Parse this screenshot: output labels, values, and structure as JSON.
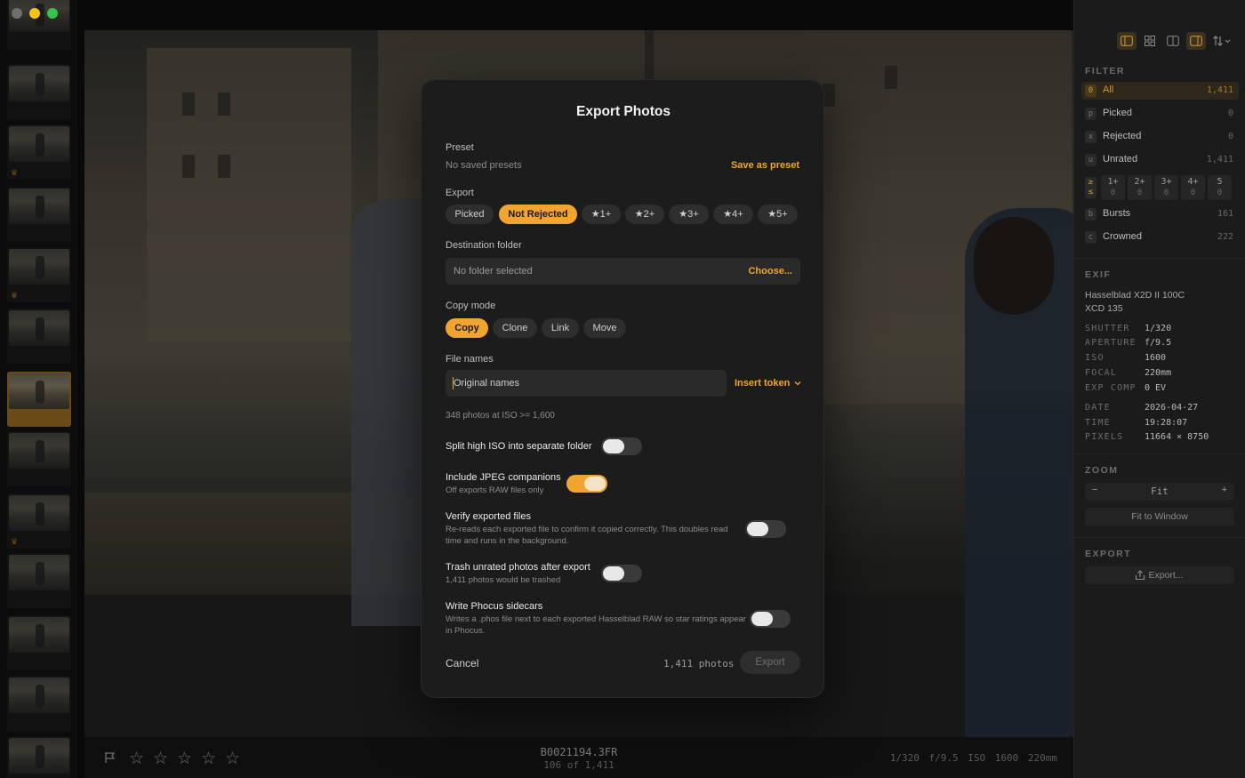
{
  "window": {
    "traffic_lights": [
      "close",
      "minimize",
      "zoom"
    ]
  },
  "filmstrip": {
    "thumbnails": [
      {
        "crowned": false,
        "selected": false
      },
      {
        "crowned": false,
        "selected": false
      },
      {
        "crowned": true,
        "selected": false
      },
      {
        "crowned": false,
        "selected": false
      },
      {
        "crowned": true,
        "selected": false
      },
      {
        "crowned": false,
        "selected": false
      },
      {
        "crowned": false,
        "selected": true
      },
      {
        "crowned": false,
        "selected": false
      },
      {
        "crowned": true,
        "selected": false
      },
      {
        "crowned": false,
        "selected": false
      },
      {
        "crowned": false,
        "selected": false
      },
      {
        "crowned": false,
        "selected": false
      },
      {
        "crowned": false,
        "selected": false
      }
    ],
    "crown_glyph": "♛"
  },
  "bottombar": {
    "filename": "B0021194.3FR",
    "position": "106 of 1,411",
    "exif_summary": "1/320  f/9.5  ISO 1600  220mm",
    "stars": [
      "☆",
      "☆",
      "☆",
      "☆",
      "☆"
    ]
  },
  "sidebar": {
    "toolbar_icons": [
      "sidebar-left-icon",
      "grid-icon",
      "compare-icon",
      "sidebar-right-icon",
      "sort-icon"
    ],
    "filter": {
      "title": "FILTER",
      "rows": [
        {
          "key": "0",
          "label": "All",
          "count": "1,411",
          "active": true
        },
        {
          "key": "p",
          "label": "Picked",
          "count": "0",
          "active": false
        },
        {
          "key": "x",
          "label": "Rejected",
          "count": "0",
          "active": false
        },
        {
          "key": "u",
          "label": "Unrated",
          "count": "1,411",
          "active": false
        }
      ],
      "star_key": "≥\n≤",
      "star_cells": [
        {
          "label": "1+",
          "count": "0"
        },
        {
          "label": "2+",
          "count": "0"
        },
        {
          "label": "3+",
          "count": "0"
        },
        {
          "label": "4+",
          "count": "0"
        },
        {
          "label": "5",
          "count": "0"
        }
      ],
      "extra_rows": [
        {
          "key": "b",
          "label": "Bursts",
          "count": "161"
        },
        {
          "key": "c",
          "label": "Crowned",
          "count": "222"
        }
      ]
    },
    "exif": {
      "title": "EXIF",
      "camera": "Hasselblad X2D II 100C",
      "lens": "XCD 135",
      "rows": [
        {
          "k": "SHUTTER",
          "v": "1/320"
        },
        {
          "k": "APERTURE",
          "v": "f/9.5"
        },
        {
          "k": "ISO",
          "v": "1600"
        },
        {
          "k": "FOCAL",
          "v": "220mm"
        },
        {
          "k": "EXP COMP",
          "v": "0 EV"
        }
      ],
      "rows2": [
        {
          "k": "DATE",
          "v": "2026-04-27"
        },
        {
          "k": "TIME",
          "v": "19:28:07"
        },
        {
          "k": "PIXELS",
          "v": "11664 × 8750"
        }
      ]
    },
    "zoom": {
      "title": "ZOOM",
      "minus": "−",
      "value": "Fit",
      "plus": "+",
      "fit_button": "Fit to Window"
    },
    "export": {
      "title": "EXPORT",
      "button": "Export..."
    }
  },
  "modal": {
    "title": "Export Photos",
    "preset": {
      "label": "Preset",
      "value": "No saved presets",
      "save_link": "Save as preset"
    },
    "export": {
      "label": "Export",
      "options": [
        "Picked",
        "Not Rejected",
        "★1+",
        "★2+",
        "★3+",
        "★4+",
        "★5+"
      ],
      "selected": "Not Rejected"
    },
    "destination": {
      "label": "Destination folder",
      "value": "No folder selected",
      "choose": "Choose..."
    },
    "copy_mode": {
      "label": "Copy mode",
      "options": [
        "Copy",
        "Clone",
        "Link",
        "Move"
      ],
      "selected": "Copy"
    },
    "file_names": {
      "label": "File names",
      "value": "Original names",
      "insert_token": "Insert token"
    },
    "iso_note": "348 photos at ISO >= 1,600",
    "options": [
      {
        "title": "Split high ISO into separate folder",
        "desc": "",
        "on": false
      },
      {
        "title": "Include JPEG companions",
        "desc": "Off exports RAW files only",
        "on": true
      },
      {
        "title": "Verify exported files",
        "desc": "Re-reads each exported file to confirm it copied correctly. This doubles read time and runs in the background.",
        "on": false
      },
      {
        "title": "Trash unrated photos after export",
        "desc": "1,411 photos would be trashed",
        "on": false
      },
      {
        "title": "Write Phocus sidecars",
        "desc": "Writes a .phos file next to each exported Hasselblad RAW so star ratings appear in Phocus.",
        "on": false
      }
    ],
    "footer": {
      "cancel": "Cancel",
      "count": "1,411 photos",
      "export": "Export"
    }
  },
  "colors": {
    "accent": "#f2a431",
    "panel": "#1c1c1c",
    "sidebar": "#1b1b1b"
  }
}
